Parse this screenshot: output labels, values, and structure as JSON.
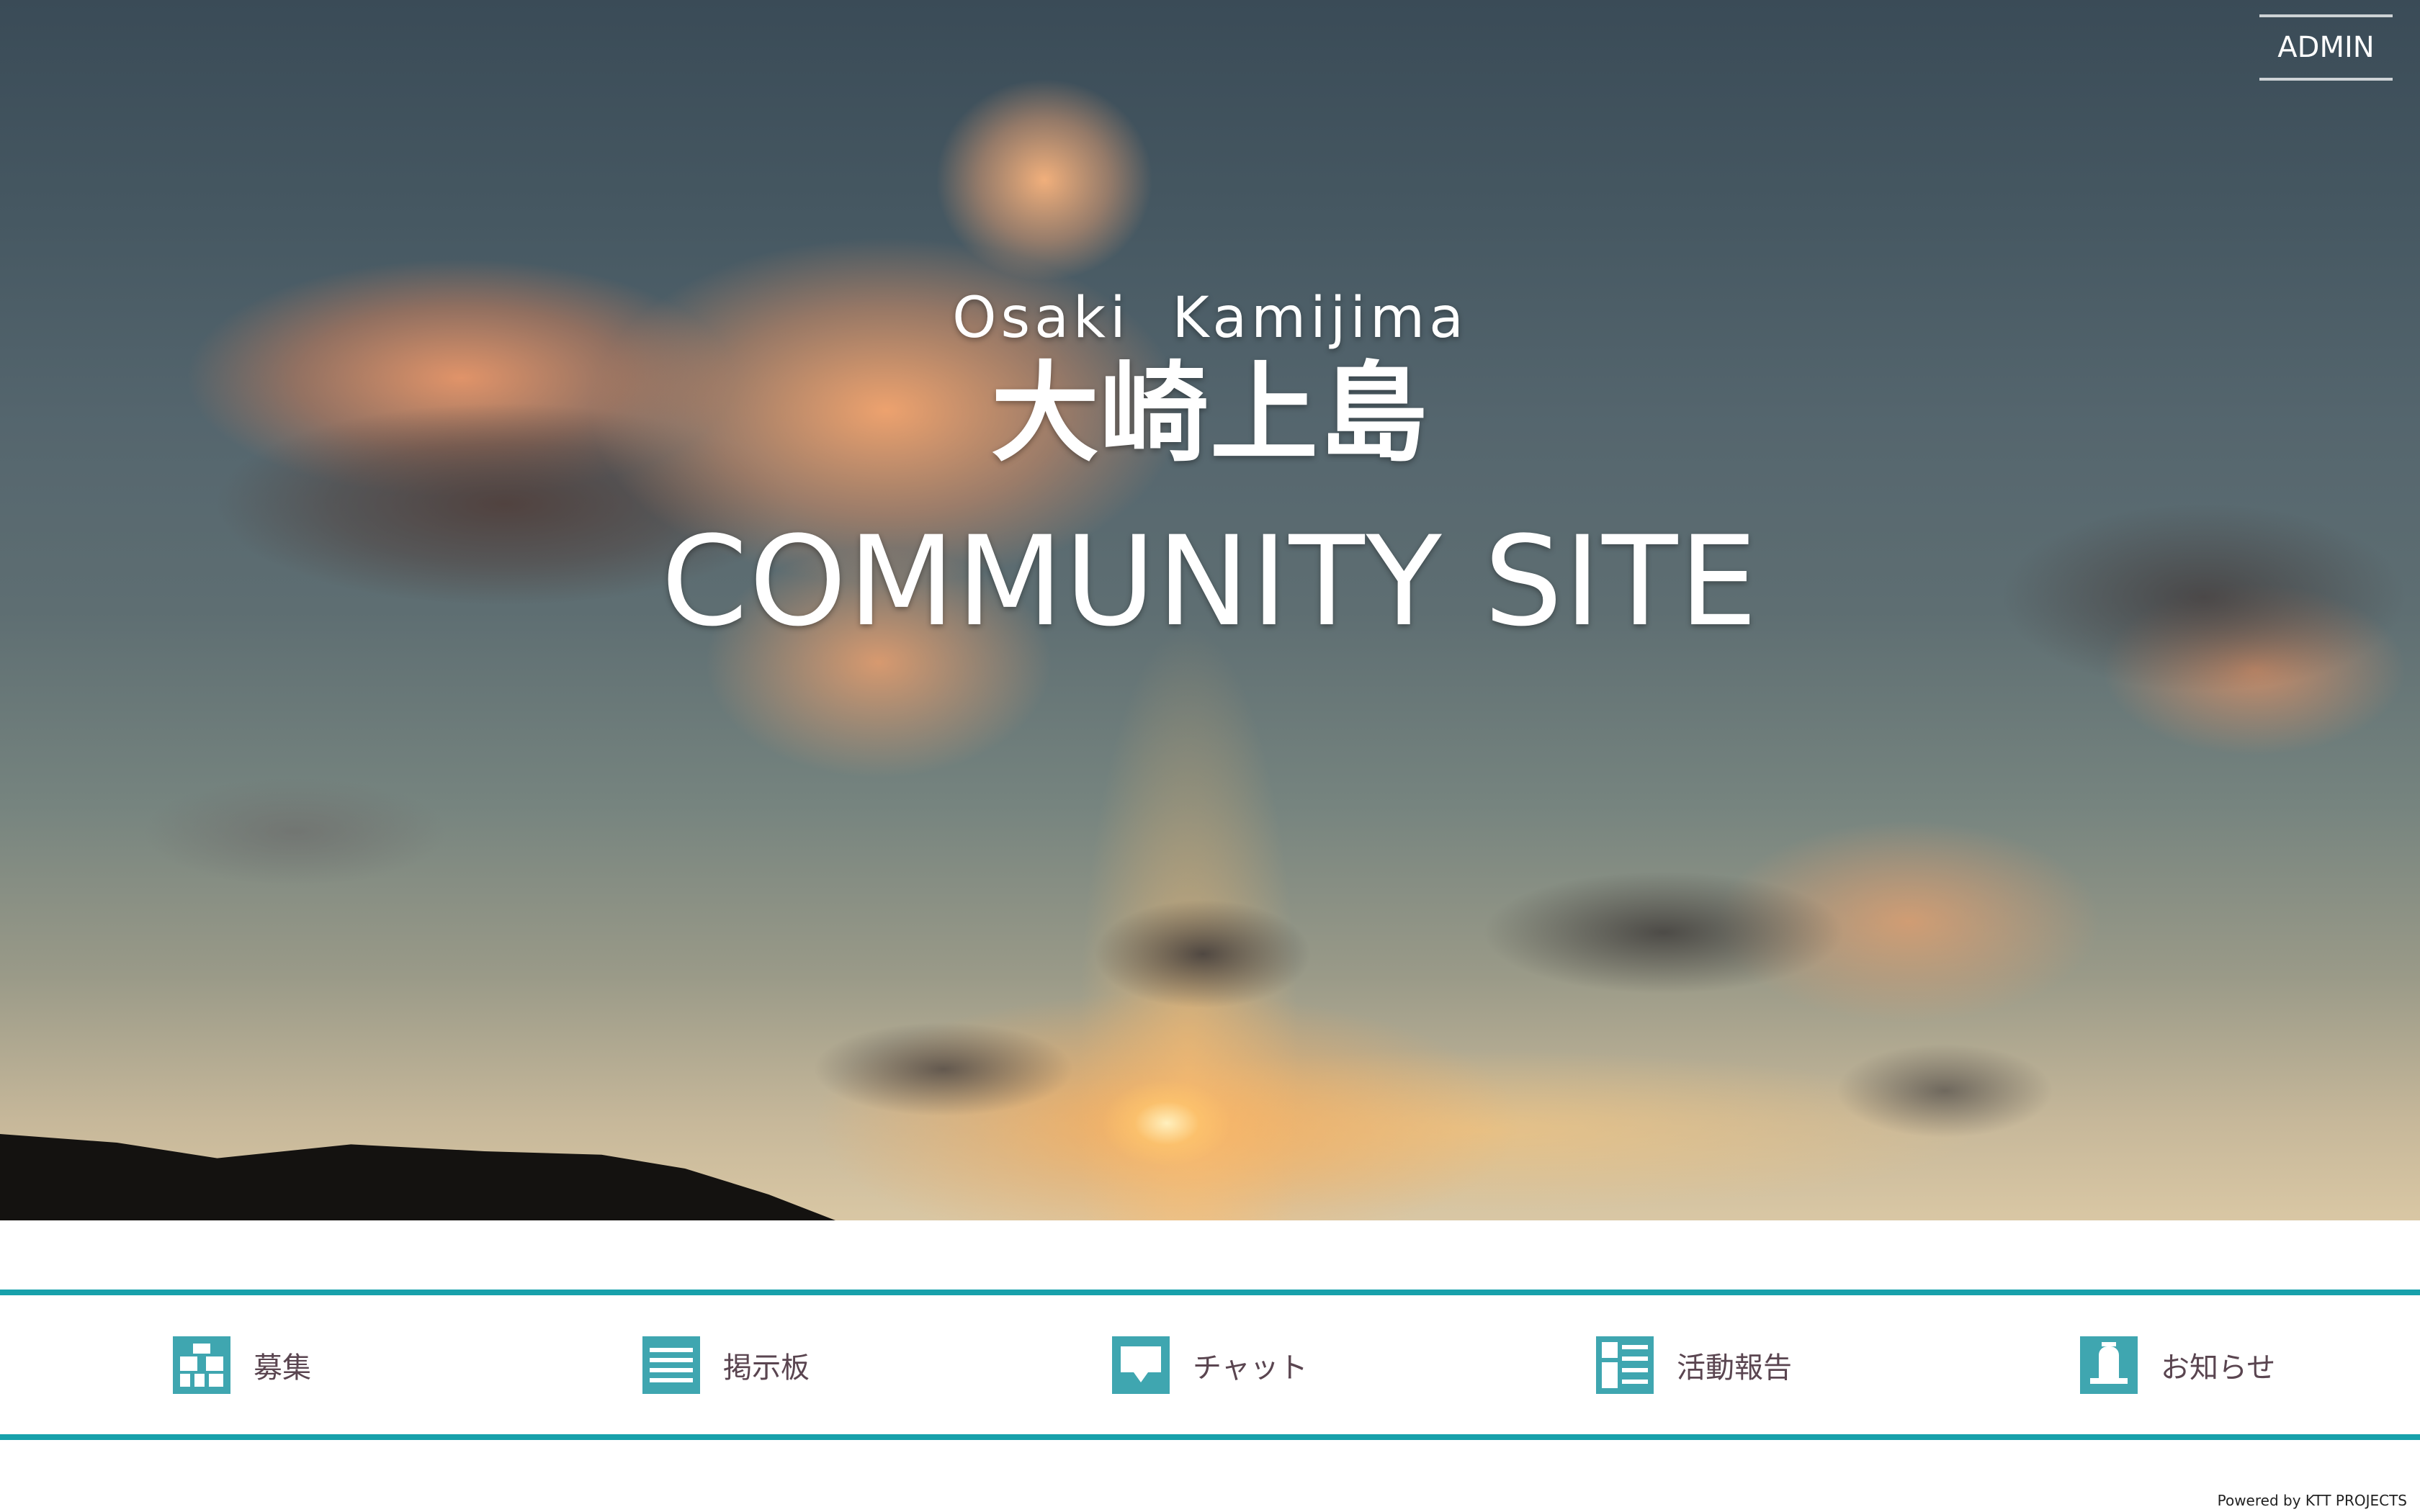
{
  "header": {
    "admin_label": "ADMIN"
  },
  "hero": {
    "subtitle_en": "Osaki Kamijima",
    "title_jp": "大崎上島",
    "site_title": "COMMUNITY SITE"
  },
  "nav": {
    "items": [
      {
        "label": "募集",
        "icon": "recruit-icon"
      },
      {
        "label": "掲示板",
        "icon": "bulletin-board-icon"
      },
      {
        "label": "チャット",
        "icon": "chat-icon"
      },
      {
        "label": "活動報告",
        "icon": "activity-report-icon"
      },
      {
        "label": "お知らせ",
        "icon": "notice-icon"
      }
    ]
  },
  "footer": {
    "credit": "Powered by KTT PROJECTS"
  },
  "colors": {
    "accent": "#17a1ab",
    "icon_bg": "#3fa6b0",
    "nav_text": "#5a4550"
  }
}
